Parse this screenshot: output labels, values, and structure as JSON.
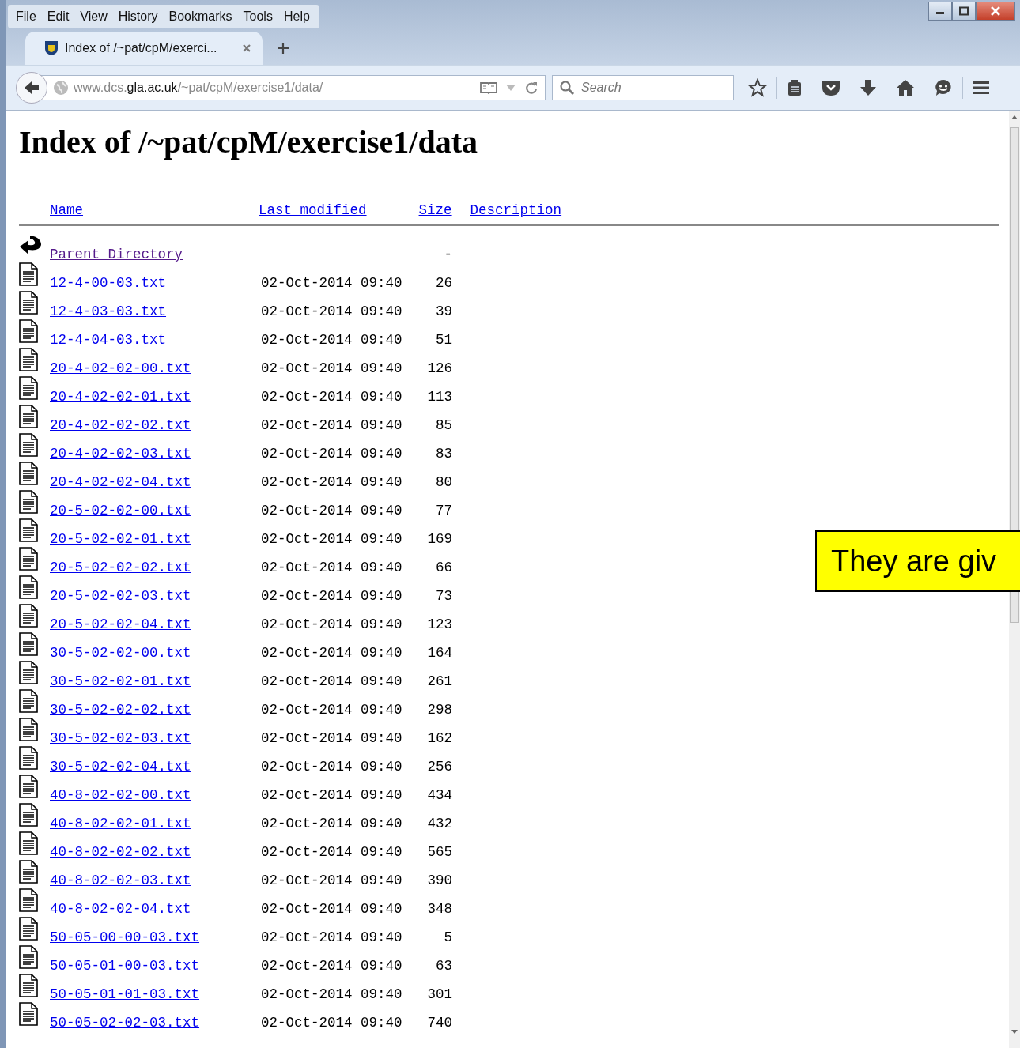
{
  "menu": [
    "File",
    "Edit",
    "View",
    "History",
    "Bookmarks",
    "Tools",
    "Help"
  ],
  "tab": {
    "title": "Index of /~pat/cpM/exerci...",
    "selected": true
  },
  "address": {
    "host_prefix": "www.dcs.",
    "host": "gla.ac.uk",
    "path": "/~pat/cpM/exercise1/data/"
  },
  "search": {
    "placeholder": "Search"
  },
  "page": {
    "heading": "Index of /~pat/cpM/exercise1/data",
    "columns": [
      "Name",
      "Last modified",
      "Size",
      "Description"
    ],
    "rows": [
      {
        "kind": "parent",
        "name": "Parent Directory",
        "size": "-",
        "visited": true
      },
      {
        "kind": "file",
        "name": "12-4-00-03.txt",
        "modified": "02-Oct-2014 09:40",
        "size": "26",
        "visited": false
      },
      {
        "kind": "file",
        "name": "12-4-03-03.txt",
        "modified": "02-Oct-2014 09:40",
        "size": "39",
        "visited": false
      },
      {
        "kind": "file",
        "name": "12-4-04-03.txt",
        "modified": "02-Oct-2014 09:40",
        "size": "51",
        "visited": false
      },
      {
        "kind": "file",
        "name": "20-4-02-02-00.txt",
        "modified": "02-Oct-2014 09:40",
        "size": "126",
        "visited": false
      },
      {
        "kind": "file",
        "name": "20-4-02-02-01.txt",
        "modified": "02-Oct-2014 09:40",
        "size": "113",
        "visited": false
      },
      {
        "kind": "file",
        "name": "20-4-02-02-02.txt",
        "modified": "02-Oct-2014 09:40",
        "size": "85",
        "visited": false
      },
      {
        "kind": "file",
        "name": "20-4-02-02-03.txt",
        "modified": "02-Oct-2014 09:40",
        "size": "83",
        "visited": false
      },
      {
        "kind": "file",
        "name": "20-4-02-02-04.txt",
        "modified": "02-Oct-2014 09:40",
        "size": "80",
        "visited": false
      },
      {
        "kind": "file",
        "name": "20-5-02-02-00.txt",
        "modified": "02-Oct-2014 09:40",
        "size": "77",
        "visited": false
      },
      {
        "kind": "file",
        "name": "20-5-02-02-01.txt",
        "modified": "02-Oct-2014 09:40",
        "size": "169",
        "visited": false
      },
      {
        "kind": "file",
        "name": "20-5-02-02-02.txt",
        "modified": "02-Oct-2014 09:40",
        "size": "66",
        "visited": false
      },
      {
        "kind": "file",
        "name": "20-5-02-02-03.txt",
        "modified": "02-Oct-2014 09:40",
        "size": "73",
        "visited": false
      },
      {
        "kind": "file",
        "name": "20-5-02-02-04.txt",
        "modified": "02-Oct-2014 09:40",
        "size": "123",
        "visited": false
      },
      {
        "kind": "file",
        "name": "30-5-02-02-00.txt",
        "modified": "02-Oct-2014 09:40",
        "size": "164",
        "visited": false
      },
      {
        "kind": "file",
        "name": "30-5-02-02-01.txt",
        "modified": "02-Oct-2014 09:40",
        "size": "261",
        "visited": false
      },
      {
        "kind": "file",
        "name": "30-5-02-02-02.txt",
        "modified": "02-Oct-2014 09:40",
        "size": "298",
        "visited": false
      },
      {
        "kind": "file",
        "name": "30-5-02-02-03.txt",
        "modified": "02-Oct-2014 09:40",
        "size": "162",
        "visited": false
      },
      {
        "kind": "file",
        "name": "30-5-02-02-04.txt",
        "modified": "02-Oct-2014 09:40",
        "size": "256",
        "visited": false
      },
      {
        "kind": "file",
        "name": "40-8-02-02-00.txt",
        "modified": "02-Oct-2014 09:40",
        "size": "434",
        "visited": false
      },
      {
        "kind": "file",
        "name": "40-8-02-02-01.txt",
        "modified": "02-Oct-2014 09:40",
        "size": "432",
        "visited": false
      },
      {
        "kind": "file",
        "name": "40-8-02-02-02.txt",
        "modified": "02-Oct-2014 09:40",
        "size": "565",
        "visited": false
      },
      {
        "kind": "file",
        "name": "40-8-02-02-03.txt",
        "modified": "02-Oct-2014 09:40",
        "size": "390",
        "visited": false
      },
      {
        "kind": "file",
        "name": "40-8-02-02-04.txt",
        "modified": "02-Oct-2014 09:40",
        "size": "348",
        "visited": false
      },
      {
        "kind": "file",
        "name": "50-05-00-00-03.txt",
        "modified": "02-Oct-2014 09:40",
        "size": "5",
        "visited": false
      },
      {
        "kind": "file",
        "name": "50-05-01-00-03.txt",
        "modified": "02-Oct-2014 09:40",
        "size": "63",
        "visited": false
      },
      {
        "kind": "file",
        "name": "50-05-01-01-03.txt",
        "modified": "02-Oct-2014 09:40",
        "size": "301",
        "visited": false
      },
      {
        "kind": "file",
        "name": "50-05-02-02-03.txt",
        "modified": "02-Oct-2014 09:40",
        "size": "740",
        "visited": false
      }
    ]
  },
  "callout": {
    "text": "They are giv"
  }
}
